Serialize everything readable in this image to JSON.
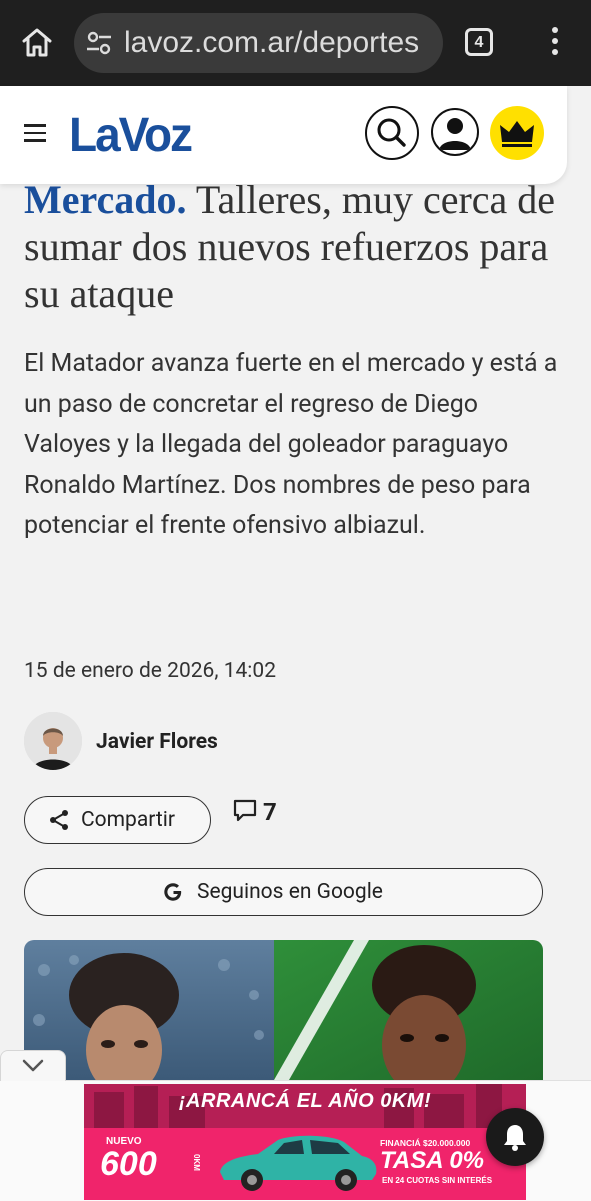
{
  "browser": {
    "url": "lavoz.com.ar/deportes",
    "tab_count": "4"
  },
  "site": {
    "logo_text": "LaVoz",
    "brand_color": "#1a4f9c",
    "premium_color": "#ffe000"
  },
  "article": {
    "kicker": "Mercado.",
    "title": "Talleres, muy cerca de sumar dos nuevos refuerzos para su ataque",
    "lead": "El Matador avanza fuerte en el mercado y está a un paso de concretar el regreso de Diego Valoyes y la llegada del goleador paraguayo Ronaldo Martínez. Dos nombres de peso para potenciar el frente ofensivo albiazul.",
    "date": "15 de enero de 2026, 14:02",
    "author": "Javier Flores",
    "share_label": "Compartir",
    "comment_count": "7",
    "google_label": "Seguinos en Google"
  },
  "ad": {
    "headline": "¡ARRANCÁ EL AÑO 0KM!",
    "badge": "NUEVO",
    "price": "600",
    "price_suffix": "0KM",
    "financing": "FINANCIÁ $20.000.000",
    "rate": "TASA 0%",
    "installments": "EN 24 CUOTAS SIN INTERÉS",
    "background_color": "#f0246b"
  },
  "icons": [
    "home-icon",
    "site-settings-icon",
    "tab-switcher-icon",
    "overflow-menu-icon",
    "hamburger-icon",
    "search-icon",
    "user-icon",
    "crown-icon",
    "share-icon",
    "comment-icon",
    "google-g-icon",
    "chevron-down-icon",
    "bell-icon"
  ]
}
